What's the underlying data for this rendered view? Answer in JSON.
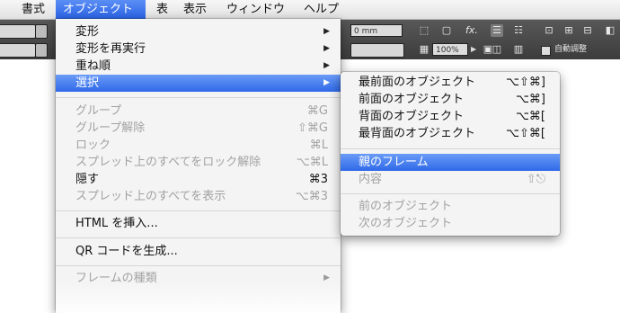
{
  "menubar": {
    "items": [
      "書式",
      "オブジェクト",
      "表",
      "表示",
      "ウィンドウ",
      "ヘルプ"
    ]
  },
  "controls": {
    "stroke_weight": "0 mm",
    "zoom": "100%",
    "auto_fit_label": "自動調整",
    "fx_label": "fx."
  },
  "object_menu": {
    "items": [
      {
        "label": "変形",
        "shortcut": "",
        "submenu": true,
        "enabled": true
      },
      {
        "label": "変形を再実行",
        "shortcut": "",
        "submenu": true,
        "enabled": true
      },
      {
        "label": "重ね順",
        "shortcut": "",
        "submenu": true,
        "enabled": true
      },
      {
        "label": "選択",
        "shortcut": "",
        "submenu": true,
        "enabled": true,
        "highlighted": true
      },
      {
        "label": "グループ",
        "shortcut": "⌘G",
        "submenu": false,
        "enabled": false
      },
      {
        "label": "グループ解除",
        "shortcut": "⇧⌘G",
        "submenu": false,
        "enabled": false
      },
      {
        "label": "ロック",
        "shortcut": "⌘L",
        "submenu": false,
        "enabled": false
      },
      {
        "label": "スプレッド上のすべてをロック解除",
        "shortcut": "⌥⌘L",
        "submenu": false,
        "enabled": false
      },
      {
        "label": "隠す",
        "shortcut": "⌘3",
        "submenu": false,
        "enabled": true
      },
      {
        "label": "スプレッド上のすべてを表示",
        "shortcut": "⌥⌘3",
        "submenu": false,
        "enabled": false
      },
      {
        "label": "HTML を挿入...",
        "shortcut": "",
        "submenu": false,
        "enabled": true
      },
      {
        "label": "QR コードを生成...",
        "shortcut": "",
        "submenu": false,
        "enabled": true
      },
      {
        "label": "フレームの種類",
        "shortcut": "",
        "submenu": true,
        "enabled": false
      }
    ]
  },
  "select_submenu": {
    "items": [
      {
        "label": "最前面のオブジェクト",
        "shortcut": "⌥⇧⌘]",
        "enabled": true
      },
      {
        "label": "前面のオブジェクト",
        "shortcut": "⌥⌘]",
        "enabled": true
      },
      {
        "label": "背面のオブジェクト",
        "shortcut": "⌥⌘[",
        "enabled": true
      },
      {
        "label": "最背面のオブジェクト",
        "shortcut": "⌥⇧⌘[",
        "enabled": true
      },
      {
        "label": "親のフレーム",
        "shortcut": "",
        "enabled": true,
        "highlighted": true
      },
      {
        "label": "内容",
        "shortcut": "⇧⎋",
        "enabled": false
      },
      {
        "label": "前のオブジェクト",
        "shortcut": "",
        "enabled": false
      },
      {
        "label": "次のオブジェクト",
        "shortcut": "",
        "enabled": false
      }
    ]
  },
  "colors": {
    "highlight": "#2f69e8",
    "toolbar": "#4a4a4a",
    "menu_bg": "#f4f4f4",
    "disabled_text": "#a2a2a2"
  }
}
